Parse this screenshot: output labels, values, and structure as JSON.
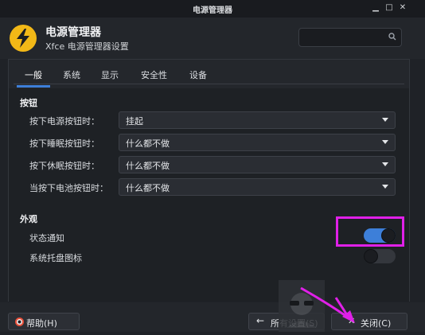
{
  "window": {
    "title": "电源管理器"
  },
  "app": {
    "name": "电源管理器",
    "subtitle": "Xfce 电源管理器设置"
  },
  "search": {
    "placeholder": "",
    "icon": "search-icon"
  },
  "tabs": [
    {
      "label": "一般",
      "active": true
    },
    {
      "label": "系统",
      "active": false
    },
    {
      "label": "显示",
      "active": false
    },
    {
      "label": "安全性",
      "active": false
    },
    {
      "label": "设备",
      "active": false
    }
  ],
  "buttons_section": {
    "title": "按钮",
    "rows": [
      {
        "label": "按下电源按钮时：",
        "value": "挂起"
      },
      {
        "label": "按下睡眠按钮时：",
        "value": "什么都不做"
      },
      {
        "label": "按下休眠按钮时：",
        "value": "什么都不做"
      },
      {
        "label": "当按下电池按钮时：",
        "value": "什么都不做"
      }
    ]
  },
  "appearance": {
    "title": "外观",
    "status_notify": {
      "label": "状态通知",
      "on": true
    },
    "tray_icon": {
      "label": "系统托盘图标",
      "on": false
    }
  },
  "footer": {
    "help_label": "帮助(H)",
    "all_settings_label": "所有设置(S)",
    "close_label": "关闭(C)"
  },
  "colors": {
    "accent": "#3d7fd9",
    "annotation": "#e020e8",
    "app_icon": "#f2b817"
  }
}
